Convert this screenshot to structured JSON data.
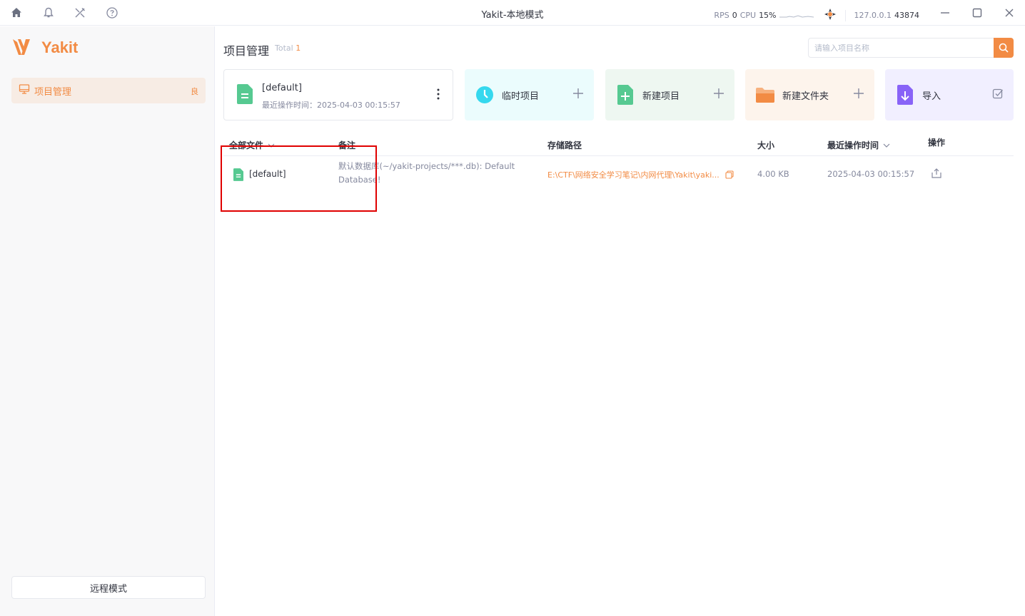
{
  "titlebar": {
    "title": "Yakit-本地模式",
    "rps_label": "RPS",
    "rps_value": "0",
    "cpu_label": "CPU",
    "cpu_value": "15%",
    "ip": "127.0.0.1",
    "port": "43874",
    "icons": [
      "home-icon",
      "bell-icon",
      "tools-icon",
      "help-icon",
      "engine-icon",
      "minimize-icon",
      "maximize-icon",
      "close-icon"
    ]
  },
  "sidebar": {
    "logo_text": "Yakit",
    "items": [
      {
        "label": "项目管理",
        "trail": "良",
        "icon": "monitor-icon",
        "active": true
      }
    ],
    "remote_button": "远程模式"
  },
  "main": {
    "title": "项目管理",
    "total_label": "Total",
    "total_count": "1",
    "search_placeholder": "请输入项目名称",
    "default_card": {
      "name": "[default]",
      "time": "最近操作时间：2025-04-03 00:15:57"
    },
    "action_cards": [
      {
        "label": "临时项目",
        "bg": "#ebfcfd",
        "icon_color": "#35d8ee"
      },
      {
        "label": "新建项目",
        "bg": "#eef7f1",
        "icon_color": "#56c991"
      },
      {
        "label": "新建文件夹",
        "bg": "#fdf4ec",
        "icon_color": "#f28b44"
      },
      {
        "label": "导入",
        "bg": "#f1efff",
        "icon_color": "#8863f7"
      }
    ],
    "table": {
      "headers": {
        "all_files": "全部文件",
        "note": "备注",
        "path": "存储路径",
        "size": "大小",
        "time": "最近操作时间",
        "action": "操作"
      },
      "rows": [
        {
          "name": "[default]",
          "note": "默认数据库(~/yakit-projects/***.db): Default Database!",
          "path": "E:\\CTF\\网络安全学习笔记\\内网代理\\Yakit\\yaki...",
          "size": "4.00 KB",
          "time": "2025-04-03 00:15:57"
        }
      ]
    }
  },
  "colors": {
    "accent": "#f28b44",
    "file_green": "#56c991",
    "annotation_red": "#e00000"
  }
}
